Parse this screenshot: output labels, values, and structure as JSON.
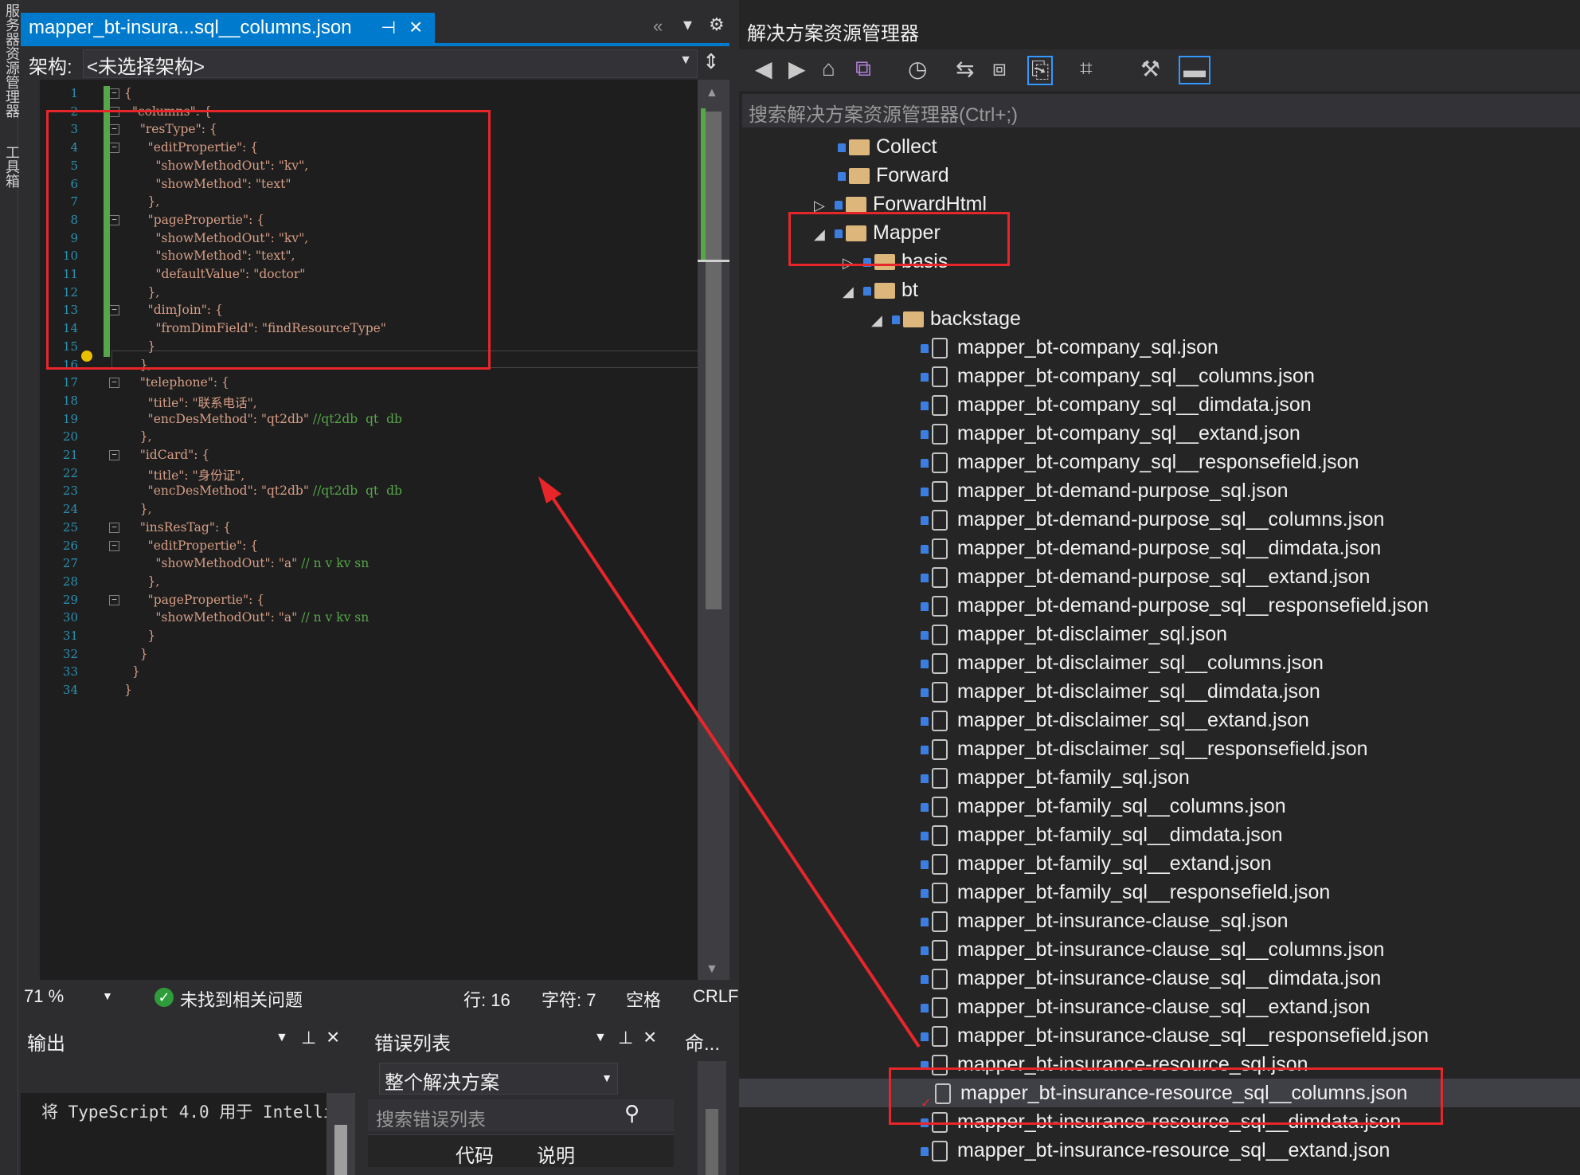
{
  "left_strip": {
    "label_top": "服务器资源管理器",
    "label_bottom": "工具箱"
  },
  "editor": {
    "tab_title": "mapper_bt-insura...sql__columns.json",
    "schema_label": "架构:",
    "schema_value": "<未选择架构>",
    "zoom": "71 %",
    "issues": "未找到相关问题",
    "row": "行: 16",
    "char": "字符: 7",
    "space": "空格",
    "eol": "CRLF",
    "line_numbers": [
      "1",
      "2",
      "3",
      "4",
      "5",
      "6",
      "7",
      "8",
      "9",
      "10",
      "11",
      "12",
      "13",
      "14",
      "15",
      "16",
      "17",
      "18",
      "19",
      "20",
      "21",
      "22",
      "23",
      "24",
      "25",
      "26",
      "27",
      "28",
      "29",
      "30",
      "31",
      "32",
      "33",
      "34"
    ],
    "code": [
      {
        "t": "{"
      },
      {
        "t": "  \"columns\": {"
      },
      {
        "t": "    \"resType\": {"
      },
      {
        "t": "      \"editPropertie\": {"
      },
      {
        "t": "        \"showMethodOut\": \"kv\","
      },
      {
        "t": "        \"showMethod\": \"text\""
      },
      {
        "t": "      },"
      },
      {
        "t": "      \"pagePropertie\": {"
      },
      {
        "t": "        \"showMethodOut\": \"kv\","
      },
      {
        "t": "        \"showMethod\": \"text\","
      },
      {
        "t": "        \"defaultValue\": \"doctor\""
      },
      {
        "t": "      },"
      },
      {
        "t": "      \"dimJoin\": {"
      },
      {
        "t": "        \"fromDimField\": \"findResourceType\""
      },
      {
        "t": "      }"
      },
      {
        "t": "    },"
      },
      {
        "t": "    \"telephone\": {"
      },
      {
        "t": "      \"title\": \"联系电话\","
      },
      {
        "t": "      \"encDesMethod\": \"qt2db\" ",
        "c": "//qt2db  qt  db"
      },
      {
        "t": "    },"
      },
      {
        "t": "    \"idCard\": {"
      },
      {
        "t": "      \"title\": \"身份证\","
      },
      {
        "t": "      \"encDesMethod\": \"qt2db\" ",
        "c": "//qt2db  qt  db"
      },
      {
        "t": "    },"
      },
      {
        "t": "    \"insResTag\": {"
      },
      {
        "t": "      \"editPropertie\": {"
      },
      {
        "t": "        \"showMethodOut\": \"a\" ",
        "c": "// n v kv sn"
      },
      {
        "t": "      },"
      },
      {
        "t": "      \"pagePropertie\": {"
      },
      {
        "t": "        \"showMethodOut\": \"a\" ",
        "c": "// n v kv sn"
      },
      {
        "t": "      }"
      },
      {
        "t": "    }"
      },
      {
        "t": "  }"
      },
      {
        "t": "}"
      }
    ]
  },
  "output": {
    "title": "输出",
    "text": "将 TypeScript 4.0 用于 Intelli"
  },
  "errors": {
    "title": "错误列表",
    "scope": "整个解决方案",
    "search_placeholder": "搜索错误列表",
    "col_code": "代码",
    "col_desc": "说明"
  },
  "command": {
    "title": "命..."
  },
  "solution": {
    "title": "解决方案资源管理器",
    "search_placeholder": "搜索解决方案资源管理器(Ctrl+;)",
    "folders": {
      "collect": "Collect",
      "forward": "Forward",
      "forwardhtml": "ForwardHtml",
      "mapper": "Mapper",
      "basis": "basis",
      "bt": "bt",
      "backstage": "backstage"
    },
    "files": [
      "mapper_bt-company_sql.json",
      "mapper_bt-company_sql__columns.json",
      "mapper_bt-company_sql__dimdata.json",
      "mapper_bt-company_sql__extand.json",
      "mapper_bt-company_sql__responsefield.json",
      "mapper_bt-demand-purpose_sql.json",
      "mapper_bt-demand-purpose_sql__columns.json",
      "mapper_bt-demand-purpose_sql__dimdata.json",
      "mapper_bt-demand-purpose_sql__extand.json",
      "mapper_bt-demand-purpose_sql__responsefield.json",
      "mapper_bt-disclaimer_sql.json",
      "mapper_bt-disclaimer_sql__columns.json",
      "mapper_bt-disclaimer_sql__dimdata.json",
      "mapper_bt-disclaimer_sql__extand.json",
      "mapper_bt-disclaimer_sql__responsefield.json",
      "mapper_bt-family_sql.json",
      "mapper_bt-family_sql__columns.json",
      "mapper_bt-family_sql__dimdata.json",
      "mapper_bt-family_sql__extand.json",
      "mapper_bt-family_sql__responsefield.json",
      "mapper_bt-insurance-clause_sql.json",
      "mapper_bt-insurance-clause_sql__columns.json",
      "mapper_bt-insurance-clause_sql__dimdata.json",
      "mapper_bt-insurance-clause_sql__extand.json",
      "mapper_bt-insurance-clause_sql__responsefield.json",
      "mapper_bt-insurance-resource_sql.json",
      "mapper_bt-insurance-resource_sql__columns.json",
      "mapper_bt-insurance-resource_sql__dimdata.json",
      "mapper_bt-insurance-resource_sql__extand.json"
    ],
    "selected_file_index": 26
  },
  "colors": {
    "accent": "#007acc",
    "highlight": "#e8262a",
    "string": "#d69d85",
    "comment": "#57a64a"
  }
}
